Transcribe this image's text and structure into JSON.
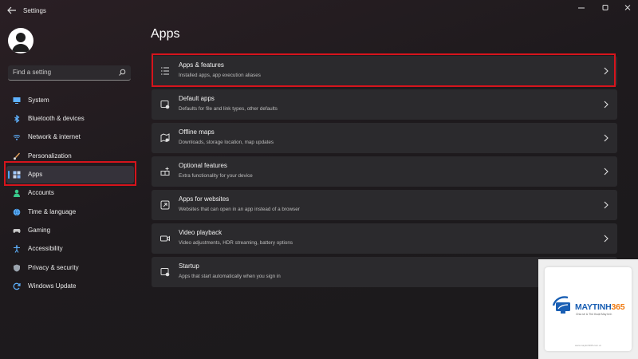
{
  "window": {
    "title": "Settings"
  },
  "search": {
    "placeholder": "Find a setting"
  },
  "sidebar": {
    "items": [
      {
        "label": "System",
        "icon": "monitor-icon"
      },
      {
        "label": "Bluetooth & devices",
        "icon": "bluetooth-icon"
      },
      {
        "label": "Network & internet",
        "icon": "wifi-icon"
      },
      {
        "label": "Personalization",
        "icon": "brush-icon"
      },
      {
        "label": "Apps",
        "icon": "apps-icon",
        "active": true
      },
      {
        "label": "Accounts",
        "icon": "person-icon"
      },
      {
        "label": "Time & language",
        "icon": "globe-icon"
      },
      {
        "label": "Gaming",
        "icon": "gamepad-icon"
      },
      {
        "label": "Accessibility",
        "icon": "accessibility-icon"
      },
      {
        "label": "Privacy & security",
        "icon": "shield-icon"
      },
      {
        "label": "Windows Update",
        "icon": "update-icon"
      }
    ]
  },
  "main": {
    "title": "Apps",
    "cards": [
      {
        "title": "Apps & features",
        "subtitle": "Installed apps, app execution aliases",
        "icon": "list-icon"
      },
      {
        "title": "Default apps",
        "subtitle": "Defaults for file and link types, other defaults",
        "icon": "default-apps-icon"
      },
      {
        "title": "Offline maps",
        "subtitle": "Downloads, storage location, map updates",
        "icon": "map-icon"
      },
      {
        "title": "Optional features",
        "subtitle": "Extra functionality for your device",
        "icon": "grid-plus-icon"
      },
      {
        "title": "Apps for websites",
        "subtitle": "Websites that can open in an app instead of a browser",
        "icon": "open-link-icon"
      },
      {
        "title": "Video playback",
        "subtitle": "Video adjustments, HDR streaming, battery options",
        "icon": "video-icon"
      },
      {
        "title": "Startup",
        "subtitle": "Apps that start automatically when you sign in",
        "icon": "startup-icon"
      }
    ]
  },
  "watermark": {
    "brand_main": "MAYTINH",
    "brand_num": "365",
    "tagline": "Chia sẻ & Thủ thuật Máy tính",
    "url": "www.maytinh365.com.vn"
  },
  "colors": {
    "accent": "#4ea8ff",
    "highlight": "#d6141c",
    "brand_blue": "#1a5fb4",
    "brand_orange": "#f07b12"
  }
}
